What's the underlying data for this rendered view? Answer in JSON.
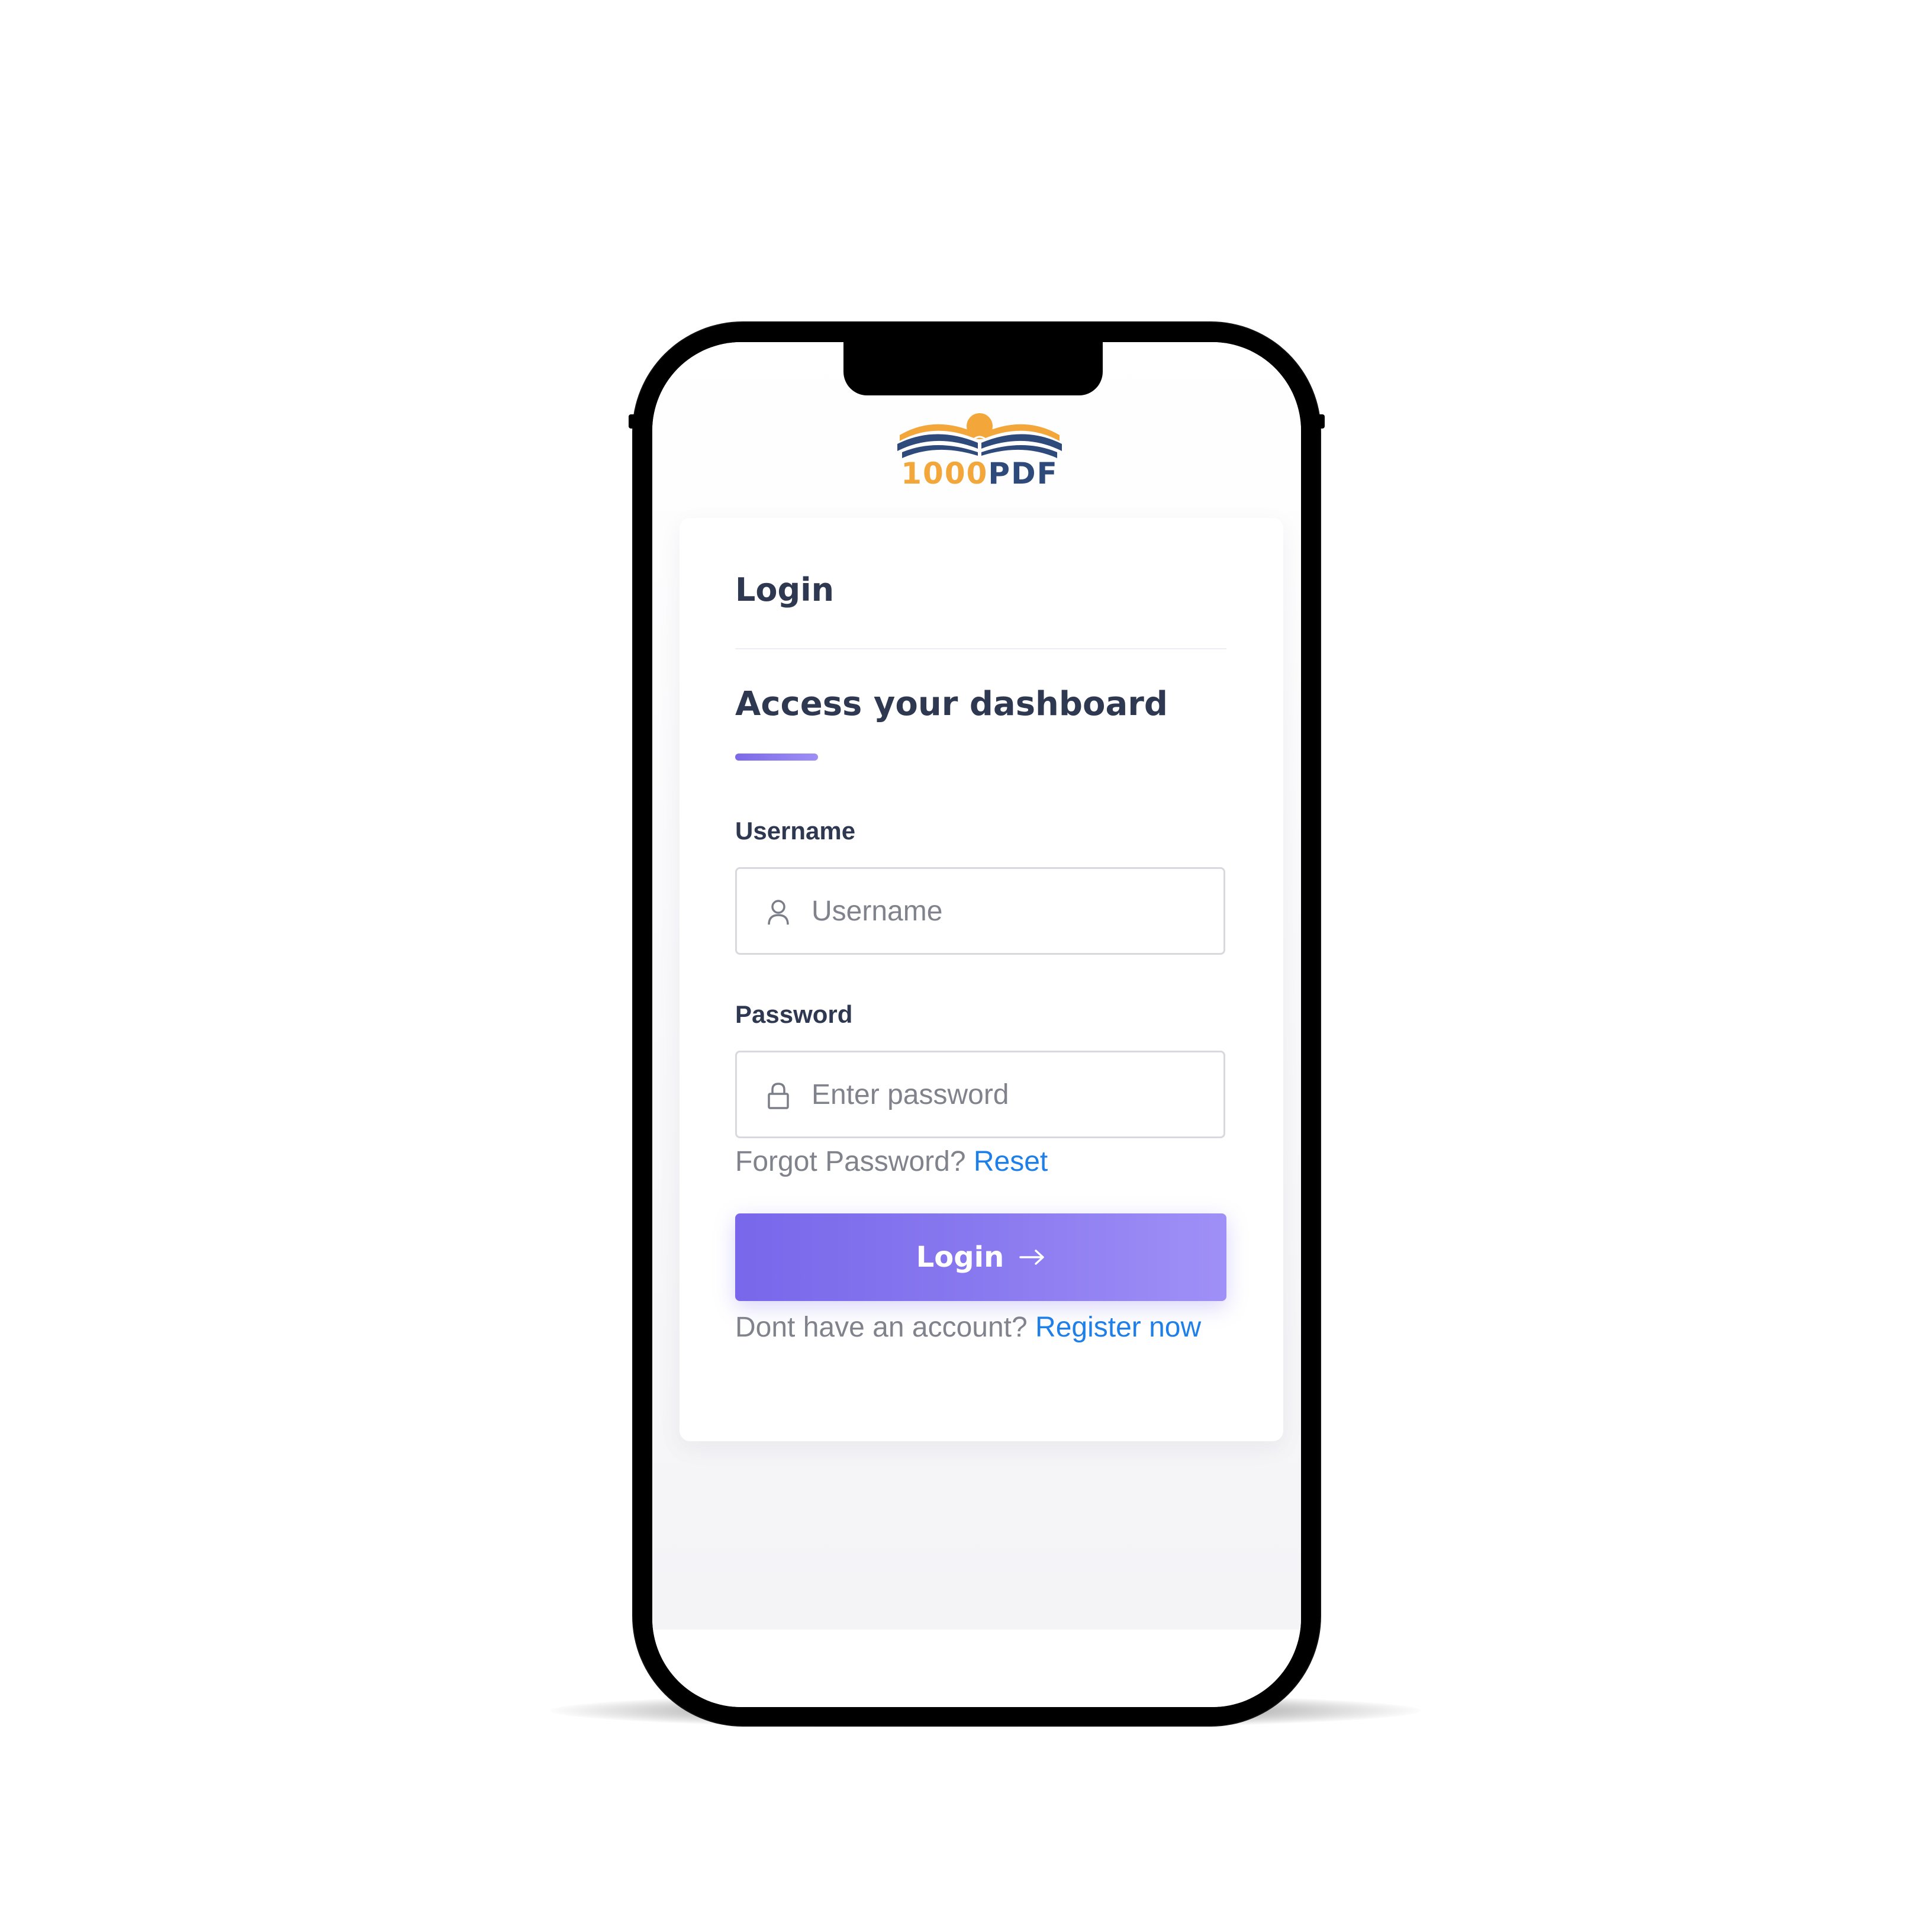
{
  "logo": {
    "text_number": "1000",
    "text_pdf": "PDF"
  },
  "card": {
    "title": "Login",
    "subtitle": "Access your dashboard"
  },
  "username": {
    "label": "Username",
    "placeholder": "Username",
    "icon": "user-icon"
  },
  "password": {
    "label": "Password",
    "placeholder": "Enter password",
    "icon": "lock-icon"
  },
  "forgot": {
    "text": "Forgot Password?",
    "link": "Reset"
  },
  "login_button": {
    "label": "Login",
    "icon": "arrow-right-icon"
  },
  "register": {
    "text": "Dont have an account?",
    "link": "Register now"
  },
  "colors": {
    "accent": "#7867ea",
    "link": "#1f7fe8",
    "heading": "#2e3850",
    "muted": "#80838c",
    "logo_orange": "#f3a73b",
    "logo_blue": "#2d4a7a"
  }
}
